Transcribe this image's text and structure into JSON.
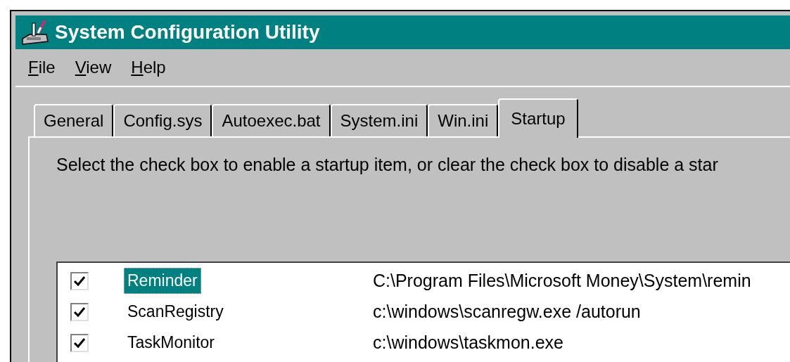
{
  "window": {
    "title": "System Configuration Utility"
  },
  "menu": [
    {
      "label": "File"
    },
    {
      "label": "View"
    },
    {
      "label": "Help"
    }
  ],
  "tabs": [
    {
      "label": "General",
      "selected": false
    },
    {
      "label": "Config.sys",
      "selected": false
    },
    {
      "label": "Autoexec.bat",
      "selected": false
    },
    {
      "label": "System.ini",
      "selected": false
    },
    {
      "label": "Win.ini",
      "selected": false
    },
    {
      "label": "Startup",
      "selected": true
    }
  ],
  "instructions": "Select the check box to enable a startup item, or clear the check box to disable a star",
  "startup_items": [
    {
      "name": "Reminder",
      "command": "C:\\Program Files\\Microsoft Money\\System\\remin",
      "checked": true,
      "selected": true
    },
    {
      "name": "ScanRegistry",
      "command": "c:\\windows\\scanregw.exe /autorun",
      "checked": true,
      "selected": false
    },
    {
      "name": "TaskMonitor",
      "command": "c:\\windows\\taskmon.exe",
      "checked": true,
      "selected": false
    }
  ]
}
